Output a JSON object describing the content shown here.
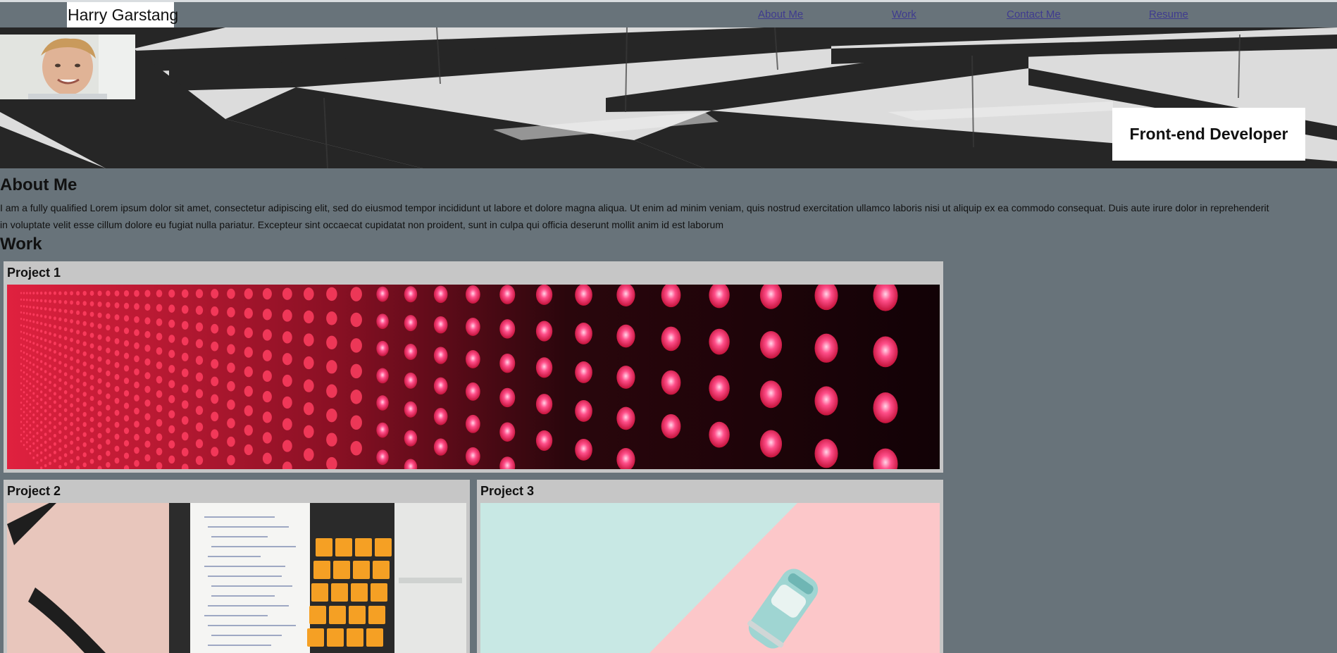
{
  "header": {
    "brand": "Harry Garstang",
    "nav": [
      "About Me",
      "Work",
      "Contact Me",
      "Resume"
    ]
  },
  "hero": {
    "tagline": "Front-end Developer"
  },
  "about": {
    "title": "About Me",
    "lines": [
      "I am a fully qualified Lorem ipsum dolor sit amet, consectetur adipiscing elit, sed do eiusmod tempor incididunt ut labore et dolore magna aliqua. Ut enim ad minim veniam, quis nostrud exercitation ullamco laboris nisi ut aliquip ex ea commodo consequat. Duis aute irure dolor in reprehenderit",
      "in voluptate velit esse cillum dolore eu fugiat nulla pariatur. Excepteur sint occaecat cupidatat non proident, sunt in culpa qui officia deserunt mollit anim id est laborum"
    ]
  },
  "work": {
    "title": "Work",
    "projects": [
      {
        "title": "Project 1"
      },
      {
        "title": "Project 2"
      },
      {
        "title": "Project 3"
      }
    ]
  },
  "colors": {
    "page_bg": "#68737a",
    "card_bg": "#c6c6c6",
    "link": "#3f3b8f"
  }
}
